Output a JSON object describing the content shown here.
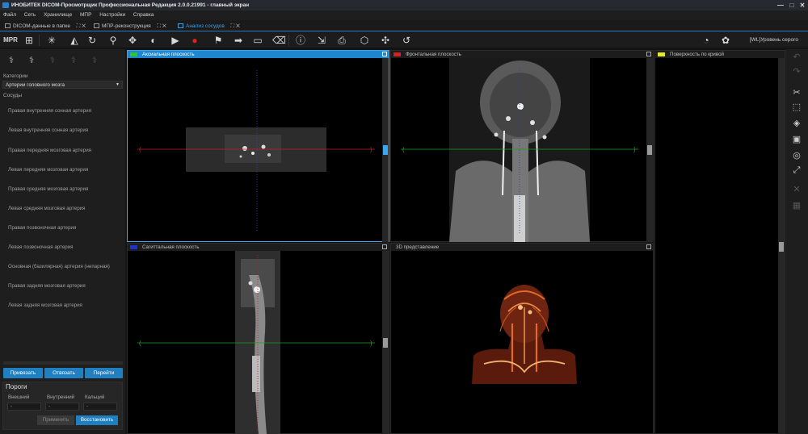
{
  "window": {
    "title": "ИНОБИТЕК DICOM-Просмотрщик Профессиональная Редакция 2.0.0.21991 - главный экран",
    "controls": [
      "—",
      "□",
      "✕"
    ]
  },
  "menu": [
    "Файл",
    "Сеть",
    "Хранилище",
    "МПР",
    "Настройки",
    "Справка"
  ],
  "tabs": [
    {
      "label": "DICOM-данные в папке"
    },
    {
      "label": "МПР-реконструкция"
    },
    {
      "label": "Анализ сосудов"
    }
  ],
  "toolbar": {
    "mode_label": "MPR",
    "wl_label": "[WL]Уровень серого"
  },
  "left_panel": {
    "category_label": "Категории",
    "category_value": "Артерии головного мозга",
    "vessels_label": "Сосуды",
    "vessels": [
      "Правая внутренняя сонная артерия",
      "Левая внутренняя сонная артерия",
      "Правая передняя мозговая артерия",
      "Левая передняя мозговая артерия",
      "Правая средняя мозговая артерия",
      "Левая средняя мозговая артерия",
      "Правая позвоночная артерия",
      "Левая позвоночная артерия",
      "Основная (базилярная) артерия (непарная)",
      "Правая задняя мозговая артерия",
      "Левая задняя мозговая артерия"
    ],
    "buttons": {
      "bind": "Привязать",
      "unbind": "Отвязать",
      "goto": "Перейти"
    },
    "thresholds": {
      "title": "Пороги",
      "outer_label": "Внешний",
      "inner_label": "Внутренний",
      "calc_label": "Кальций",
      "outer_value": "-",
      "inner_value": "-",
      "calc_value": "-",
      "apply": "Применить",
      "restore": "Восстановить"
    }
  },
  "viewports": {
    "axial": {
      "title": "Аксиальная плоскость",
      "color": "#2fc42f"
    },
    "frontal": {
      "title": "Фронтальная плоскость",
      "color": "#d62020"
    },
    "curved": {
      "title": "Поверхность по кривой",
      "color": "#e6e62a"
    },
    "sagittal": {
      "title": "Сагиттальная плоскость",
      "color": "#2030d0"
    },
    "volume": {
      "title": "3D представление"
    }
  },
  "crosshair_colors": {
    "red": "#c02020",
    "green": "#20a020",
    "blue": "#3040c8"
  },
  "accent": "#1e86cf"
}
